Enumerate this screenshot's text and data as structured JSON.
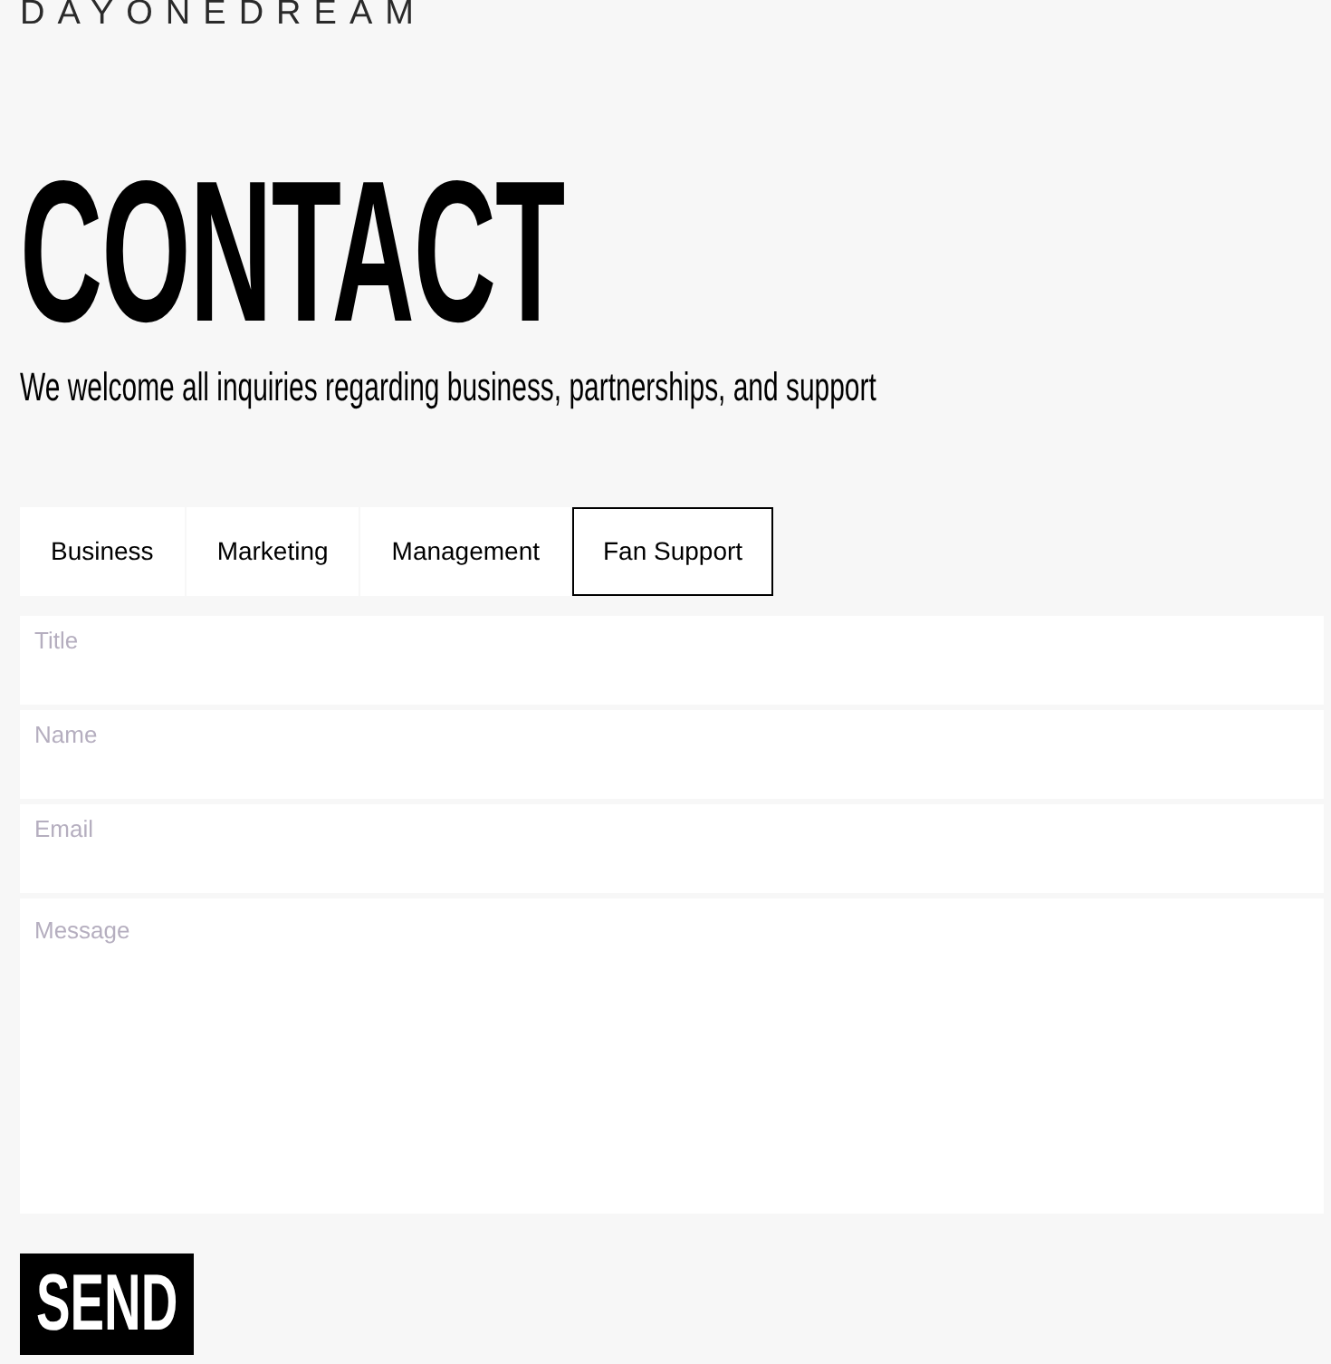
{
  "logo": {
    "text": "DAYONEDREAM"
  },
  "heading": "CONTACT",
  "subtitle": "We welcome all inquiries regarding business, partnerships, and support",
  "tabs": [
    {
      "label": "Business",
      "selected": false
    },
    {
      "label": "Marketing",
      "selected": false
    },
    {
      "label": "Management",
      "selected": false
    },
    {
      "label": "Fan Support",
      "selected": true
    }
  ],
  "form": {
    "fields": [
      {
        "kind": "input",
        "placeholder": "Title"
      },
      {
        "kind": "input",
        "placeholder": "Name"
      },
      {
        "kind": "input",
        "placeholder": "Email"
      },
      {
        "kind": "textarea",
        "placeholder": "Message"
      }
    ]
  },
  "send_button": {
    "label": "SEND"
  }
}
